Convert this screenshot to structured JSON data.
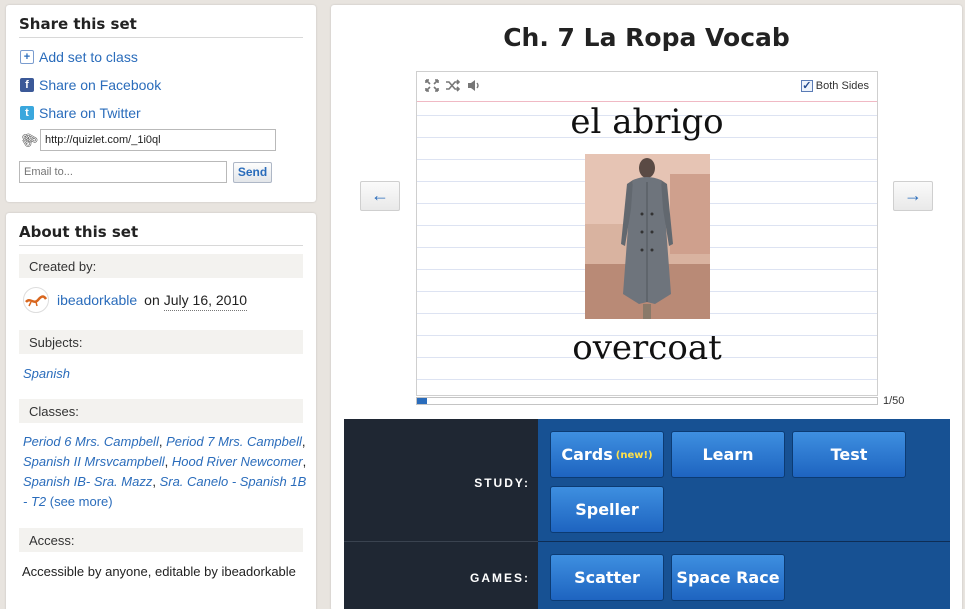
{
  "share": {
    "title": "Share this set",
    "add_to_class": "Add set to class",
    "facebook": "Share on Facebook",
    "twitter": "Share on Twitter",
    "url": "http://quizlet.com/_1i0ql",
    "email_placeholder": "Email to...",
    "send_label": "Send"
  },
  "about": {
    "title": "About this set",
    "created_by_label": "Created by:",
    "creator": "ibeadorkable",
    "created_on": "on",
    "date": "July 16, 2010",
    "subjects_label": "Subjects:",
    "subjects": [
      "Spanish"
    ],
    "classes_label": "Classes:",
    "classes": [
      "Period 6 Mrs. Campbell",
      "Period 7 Mrs. Campbell",
      "Spanish II Mrsvcampbell",
      "Hood River Newcomer",
      "Spanish IB- Sra. Mazz",
      "Sra. Canelo - Spanish 1B - T2"
    ],
    "see_more": "(see more)",
    "access_label": "Access:",
    "access_text": "Accessible by anyone, editable by ibeadorkable"
  },
  "main": {
    "title": "Ch. 7 La Ropa Vocab",
    "card": {
      "term": "el abrigo",
      "definition": "overcoat",
      "both_sides_label": "Both Sides",
      "both_sides_checked": true,
      "tools": [
        "expand-icon",
        "shuffle-icon",
        "speaker-icon"
      ]
    },
    "prev_label": "←",
    "next_label": "→",
    "progress": {
      "current": 1,
      "total": 50,
      "text": "1/50"
    }
  },
  "modes": {
    "study_label": "STUDY:",
    "games_label": "GAMES:",
    "study": [
      {
        "label": "Cards",
        "badge": "(new!)"
      },
      {
        "label": "Learn"
      },
      {
        "label": "Test"
      },
      {
        "label": "Speller"
      }
    ],
    "games": [
      {
        "label": "Scatter"
      },
      {
        "label": "Space Race"
      }
    ]
  },
  "colors": {
    "link": "#2a6cbb",
    "modes_bg": "#175193",
    "modes_label_bg": "#1f2733",
    "button_top": "#3e8fe0",
    "button_bottom": "#1e64c0",
    "new_badge": "#ffe14a"
  }
}
